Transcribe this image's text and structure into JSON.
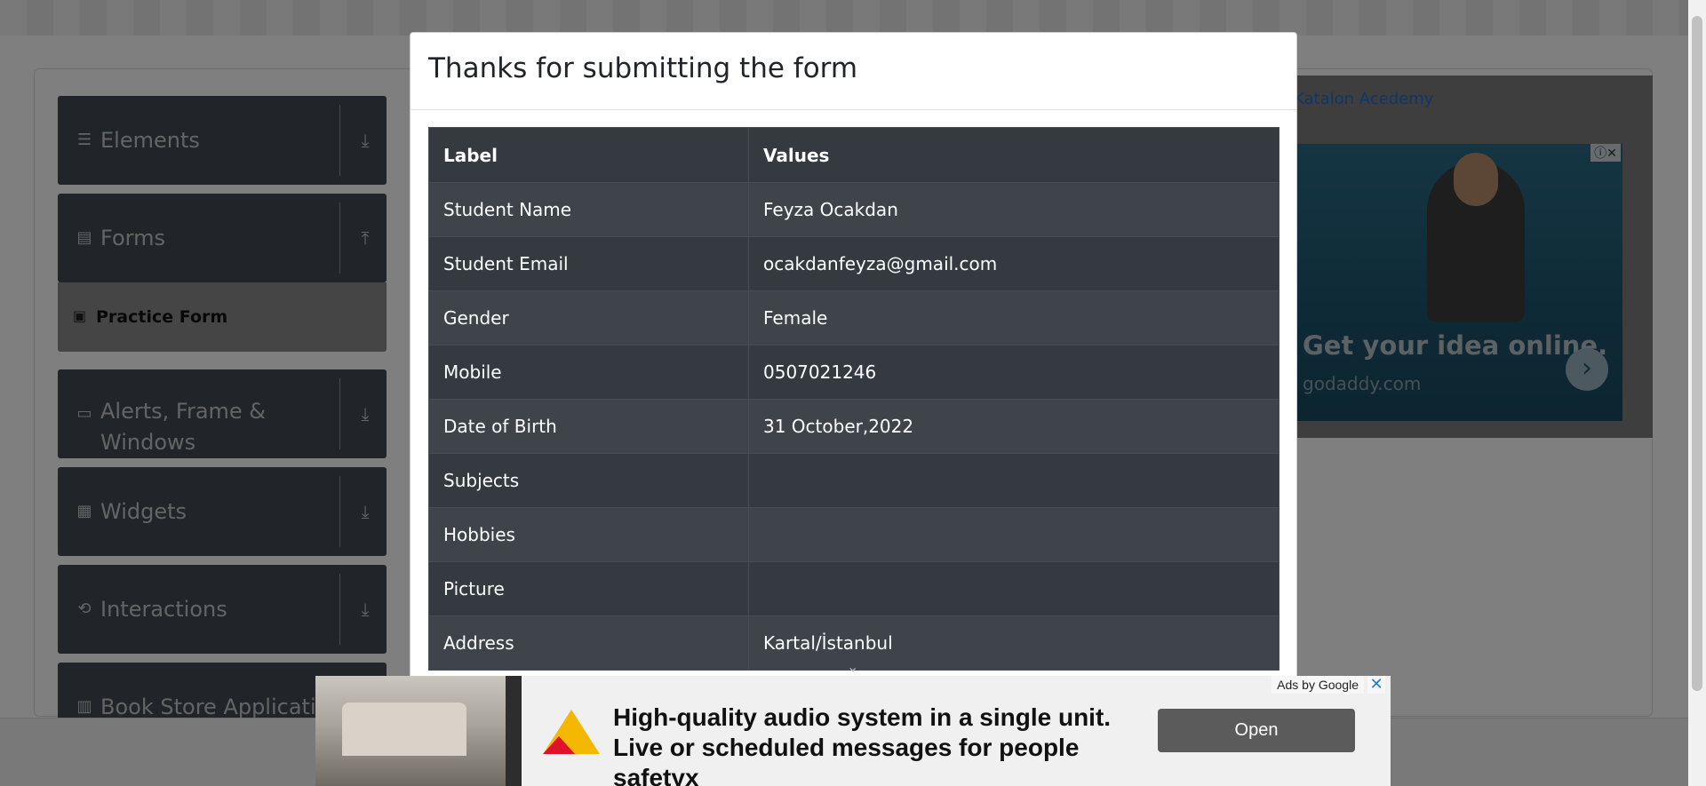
{
  "sidebar": {
    "groups": [
      {
        "icon": "menu-icon",
        "label": "Elements",
        "chevron": "download-icon"
      },
      {
        "icon": "document-icon",
        "label": "Forms",
        "chevron": "upload-icon"
      },
      {
        "icon": "window-icon",
        "label": "Alerts, Frame & Windows",
        "chevron": "download-icon"
      },
      {
        "icon": "widgets-icon",
        "label": "Widgets",
        "chevron": "download-icon"
      },
      {
        "icon": "interactions-icon",
        "label": "Interactions",
        "chevron": "download-icon"
      },
      {
        "icon": "books-icon",
        "label": "Book Store Application",
        "chevron": "download-icon"
      }
    ],
    "active_item": "Practice Form"
  },
  "right_ad": {
    "link_text": "Katalon Acedemy",
    "headline": "Get your idea online.",
    "domain": "godaddy.com"
  },
  "modal": {
    "title": "Thanks for submitting the form",
    "table": {
      "headers": [
        "Label",
        "Values"
      ],
      "rows": [
        [
          "Student Name",
          "Feyza Ocakdan"
        ],
        [
          "Student Email",
          "ocakdanfeyza@gmail.com"
        ],
        [
          "Gender",
          "Female"
        ],
        [
          "Mobile",
          "0507021246"
        ],
        [
          "Date of Birth",
          "31 October,2022"
        ],
        [
          "Subjects",
          ""
        ],
        [
          "Hobbies",
          ""
        ],
        [
          "Picture",
          ""
        ],
        [
          "Address",
          "Kartal/İstanbul"
        ]
      ]
    }
  },
  "bottom_ad": {
    "ads_by": "Ads by Google",
    "headline": "High-quality audio system in a single unit. Live or scheduled messages for people safetyx",
    "button": "Open"
  }
}
